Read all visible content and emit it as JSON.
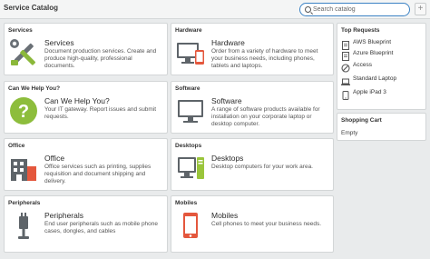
{
  "header": {
    "title": "Service Catalog",
    "search_placeholder": "Search catalog",
    "add_label": "+"
  },
  "categories": [
    {
      "header": "Services",
      "title": "Services",
      "desc": "Document production services. Create and produce high-quality, professional documents.",
      "icon": "tools-icon"
    },
    {
      "header": "Hardware",
      "title": "Hardware",
      "desc": "Order from a variety of hardware to meet your business needs, including phones, tablets and laptops.",
      "icon": "hardware-icon"
    },
    {
      "header": "Can We Help You?",
      "title": "Can We Help You?",
      "desc": "Your IT gateway. Report issues and submit requests.",
      "icon": "help-icon"
    },
    {
      "header": "Software",
      "title": "Software",
      "desc": "A range of software products available for installation on your corporate laptop or desktop computer.",
      "icon": "monitor-icon"
    },
    {
      "header": "Office",
      "title": "Office",
      "desc": "Office services such as printing, supplies requisition and document shipping and delivery.",
      "icon": "building-icon"
    },
    {
      "header": "Desktops",
      "title": "Desktops",
      "desc": "Desktop computers for your work area.",
      "icon": "desktop-icon"
    },
    {
      "header": "Peripherals",
      "title": "Peripherals",
      "desc": "End user peripherals such as mobile phone cases, dongles, and cables",
      "icon": "peripherals-icon"
    },
    {
      "header": "Mobiles",
      "title": "Mobiles",
      "desc": "Cell phones to meet your business needs.",
      "icon": "mobile-icon"
    }
  ],
  "top_requests": {
    "header": "Top Requests",
    "items": [
      {
        "label": "AWS Blueprint",
        "icon": "blueprint-icon"
      },
      {
        "label": "Azure Blueprint",
        "icon": "blueprint-icon"
      },
      {
        "label": "Access",
        "icon": "no-access-icon"
      },
      {
        "label": "Standard Laptop",
        "icon": "laptop-icon"
      },
      {
        "label": "Apple iPad 3",
        "icon": "ipad-icon"
      }
    ]
  },
  "cart": {
    "header": "Shopping Cart",
    "empty": "Empty"
  },
  "colors": {
    "accent": "#3c82c4",
    "help_green": "#8dbd3c",
    "mobile_red": "#e4573d",
    "desktop_green": "#9ac53b"
  }
}
